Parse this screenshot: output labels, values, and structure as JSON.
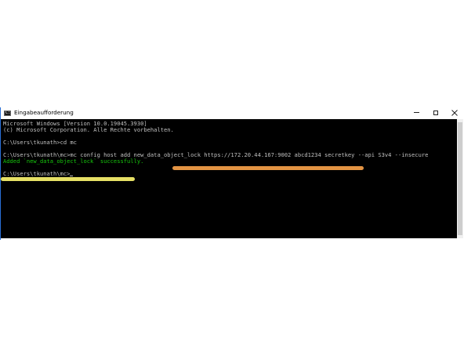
{
  "window": {
    "title": "Eingabeaufforderung",
    "icon": "cmd-icon",
    "icon_glyph": "C:\\"
  },
  "controls": {
    "minimize_icon": "minimize-icon",
    "maximize_icon": "maximize-icon",
    "close_icon": "close-icon"
  },
  "console": {
    "lines": [
      "Microsoft Windows [Version 10.0.19045.3930]",
      "(c) Microsoft Corporation. Alle Rechte vorbehalten.",
      "C:\\Users\\tkunath>cd mc",
      "C:\\Users\\tkunath\\mc>mc config host add new_data_object_lock https://172.20.44.167:9002 abcd1234 secretkey --api S3v4 --insecure",
      "Added `new_data_object_lock` successfully.",
      "C:\\Users\\tkunath\\mc>"
    ]
  },
  "colors": {
    "console_background": "#000000",
    "console_text": "#c0c0c0",
    "success_text": "#16c60c",
    "highlight_orange": "#f6a14a",
    "highlight_yellow": "#f2ec6a",
    "window_border": "#2a6fd6"
  }
}
